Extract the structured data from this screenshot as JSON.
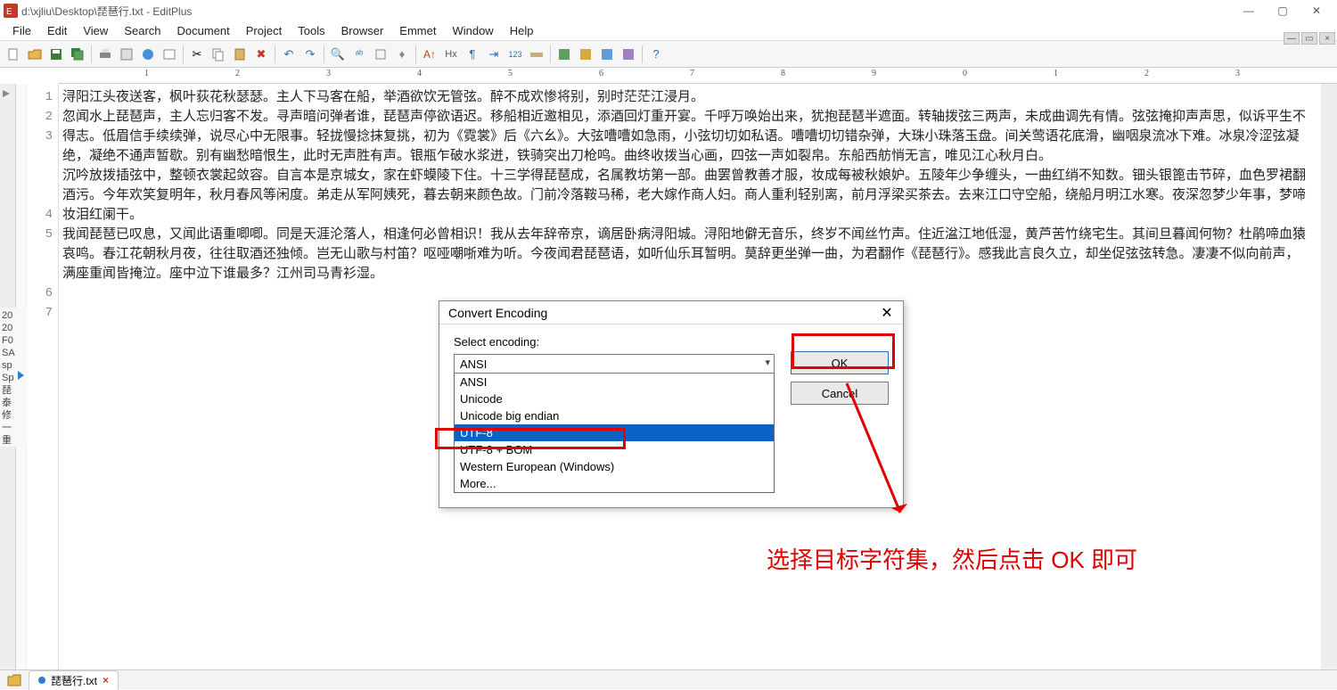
{
  "title": "d:\\xjliu\\Desktop\\琵琶行.txt - EditPlus",
  "menu": [
    "File",
    "Edit",
    "View",
    "Search",
    "Document",
    "Project",
    "Tools",
    "Browser",
    "Emmet",
    "Window",
    "Help"
  ],
  "ruler_marks": [
    "1",
    "2",
    "3",
    "4",
    "5",
    "6",
    "7",
    "8",
    "9",
    "0",
    "1",
    "2",
    "3"
  ],
  "lines": {
    "l1": "浔阳江头夜送客，枫叶荻花秋瑟瑟。主人下马客在船，举酒欲饮无管弦。醉不成欢惨将别，别时茫茫江浸月。",
    "l2": "",
    "l3": "忽闻水上琵琶声，主人忘归客不发。寻声暗问弹者谁，琵琶声停欲语迟。移船相近邀相见，添酒回灯重开宴。千呼万唤始出来，犹抱琵琶半遮面。转轴拨弦三两声，未成曲调先有情。弦弦掩抑声声思，似诉平生不得志。低眉信手续续弹，说尽心中无限事。轻拢慢捻抹复挑，初为《霓裳》后《六幺》。大弦嘈嘈如急雨，小弦切切如私语。嘈嘈切切错杂弹，大珠小珠落玉盘。间关莺语花底滑，幽咽泉流冰下难。冰泉冷涩弦凝绝，凝绝不通声暂歇。别有幽愁暗恨生，此时无声胜有声。银瓶乍破水浆迸，铁骑突出刀枪鸣。曲终收拨当心画，四弦一声如裂帛。东船西舫悄无言，唯见江心秋月白。",
    "l4": "",
    "l5": "沉吟放拨插弦中，整顿衣裳起敛容。自言本是京城女，家在虾蟆陵下住。十三学得琵琶成，名属教坊第一部。曲罢曾教善才服，妆成每被秋娘妒。五陵年少争缠头，一曲红绡不知数。钿头银篦击节碎，血色罗裙翻酒污。今年欢笑复明年，秋月春风等闲度。弟走从军阿姨死，暮去朝来颜色故。门前冷落鞍马稀，老大嫁作商人妇。商人重利轻别离，前月浮梁买茶去。去来江口守空船，绕船月明江水寒。夜深忽梦少年事，梦啼妆泪红阑干。",
    "l6": "",
    "l7": "我闻琵琶已叹息，又闻此语重唧唧。同是天涯沦落人，相逢何必曾相识！我从去年辞帝京，谪居卧病浔阳城。浔阳地僻无音乐，终岁不闻丝竹声。住近湓江地低湿，黄芦苦竹绕宅生。其间旦暮闻何物？杜鹃啼血猿哀鸣。春江花朝秋月夜，往往取酒还独倾。岂无山歌与村笛？呕哑嘲哳难为听。今夜闻君琵琶语，如听仙乐耳暂明。莫辞更坐弹一曲，为君翻作《琵琶行》。感我此言良久立，却坐促弦弦转急。凄凄不似向前声，满座重闻皆掩泣。座中泣下谁最多？江州司马青衫湿。"
  },
  "line_numbers": [
    "1",
    "2",
    "3",
    "4",
    "5",
    "6",
    "7"
  ],
  "side_labels": [
    "20",
    "20",
    "F0",
    "SA",
    "sp",
    "Sp",
    "琵",
    "泰",
    "修",
    "一",
    "重"
  ],
  "dialog": {
    "title": "Convert Encoding",
    "label": "Select encoding:",
    "selected": "ANSI",
    "options": [
      "ANSI",
      "Unicode",
      "Unicode big endian",
      "UTF-8",
      "UTF-8 + BOM",
      "Western European (Windows)",
      "More..."
    ],
    "highlight_index": 3,
    "ok": "OK",
    "cancel": "Cancel"
  },
  "annotation": "选择目标字符集，然后点击 OK 即可",
  "tab": {
    "name": "琵琶行.txt"
  }
}
